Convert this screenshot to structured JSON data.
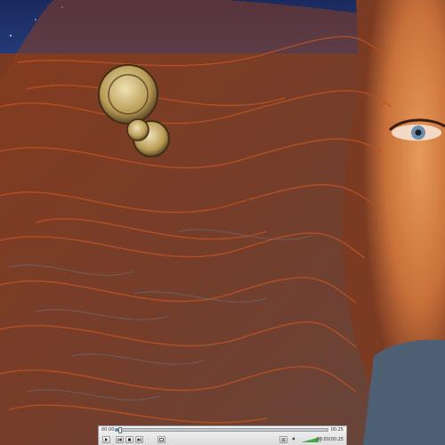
{
  "player": {
    "time_elapsed": "00:00",
    "time_total": "00:25",
    "counter": "00:00/00:25",
    "progress_fraction": 0.02,
    "volume_fraction": 0.85,
    "accent_color": "#4f86c6",
    "volume_color": "#3fae3f",
    "buttons": [
      {
        "name": "play-icon"
      },
      {
        "name": "previous-icon"
      },
      {
        "name": "stop-icon"
      },
      {
        "name": "next-icon"
      },
      {
        "name": "fullscreen-icon"
      },
      {
        "name": "playlist-icon"
      },
      {
        "name": "speaker-icon"
      }
    ]
  }
}
